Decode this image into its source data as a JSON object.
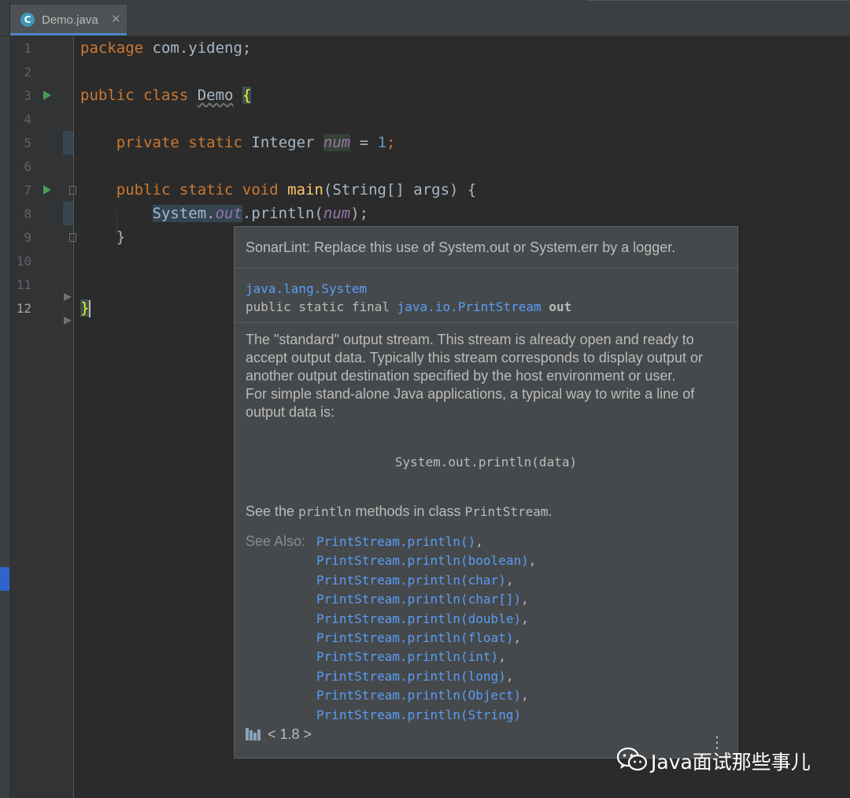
{
  "tab": {
    "icon_letter": "C",
    "name": "Demo.java",
    "close": "✕"
  },
  "line_numbers": [
    "1",
    "2",
    "3",
    "4",
    "5",
    "6",
    "7",
    "8",
    "9",
    "10",
    "11",
    "12"
  ],
  "code": {
    "l1_kw": "package",
    "l1_rest": " com.yideng;",
    "l3_kw": "public class",
    "l3_name": "Demo",
    "l3_brace": "{",
    "l5_kw": "private static",
    "l5_type": "Integer",
    "l5_field": "num",
    "l5_eq": " = ",
    "l5_num": "1",
    "l5_end": ";",
    "l7_kw": "public static void",
    "l7_fn": "main",
    "l7_rest": "(String[] args) {",
    "l8_sys": "System.",
    "l8_out": "out",
    "l8_mid": ".println(",
    "l8_field": "num",
    "l8_end": ");",
    "l9": "}",
    "l12": "}"
  },
  "popup": {
    "header": "SonarLint: Replace this use of System.out or System.err by a logger.",
    "def_class": "java.lang.System",
    "def_prefix": "public static final ",
    "def_type": "java.io.PrintStream",
    "def_name": "out",
    "body_p1": "The \"standard\" output stream. This stream is already open and ready to accept output data. Typically this stream corresponds to display output or another output destination specified by the host environment or user.",
    "body_p2": "For simple stand-alone Java applications, a typical way to write a line of output data is:",
    "code_example": "System.out.println(data)",
    "see_pre": "See the ",
    "see_code1": "println",
    "see_mid": " methods in class ",
    "see_code2": "PrintStream",
    "see_end": ".",
    "see_also_label": "See Also:",
    "see_also": [
      {
        "link": "PrintStream.println()",
        "sep": ","
      },
      {
        "link": "PrintStream.println(boolean)",
        "sep": ","
      },
      {
        "link": "PrintStream.println(char)",
        "sep": ","
      },
      {
        "link": "PrintStream.println(char[])",
        "sep": ","
      },
      {
        "link": "PrintStream.println(double)",
        "sep": ","
      },
      {
        "link": "PrintStream.println(float)",
        "sep": ","
      },
      {
        "link": "PrintStream.println(int)",
        "sep": ","
      },
      {
        "link": "PrintStream.println(long)",
        "sep": ","
      },
      {
        "link": "PrintStream.println(Object)",
        "sep": ","
      },
      {
        "link": "PrintStream.println(String)",
        "sep": ""
      }
    ],
    "footer": "< 1.8 >",
    "more": "⋮"
  },
  "watermark": "Java面试那些事儿",
  "colors": {
    "accent": "#4a88c7",
    "keyword": "#cc7832",
    "link": "#589df6",
    "run": "#499c54"
  }
}
